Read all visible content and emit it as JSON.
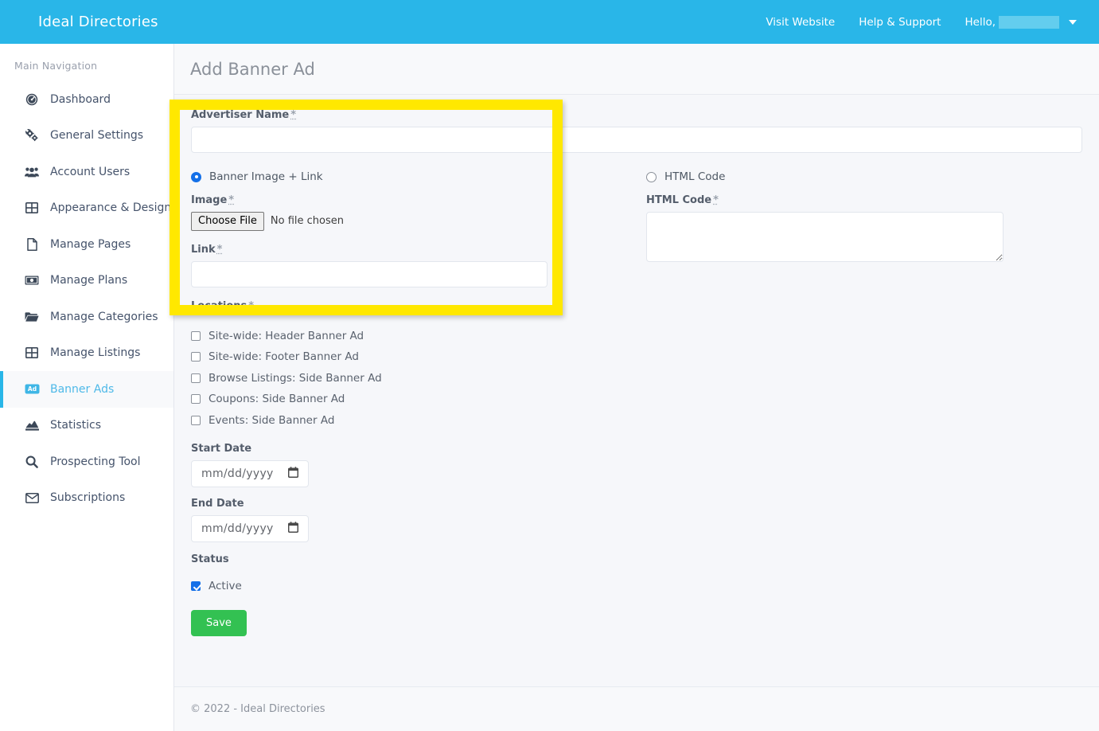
{
  "header": {
    "brand": "Ideal Directories",
    "links": [
      {
        "label": "Visit Website",
        "name": "visit-website"
      },
      {
        "label": "Help & Support",
        "name": "help-support"
      }
    ],
    "hello_label": "Hello,",
    "hello_user": "",
    "brand_color": "#29b6e8"
  },
  "sidebar": {
    "title": "Main Navigation",
    "items": [
      {
        "label": "Dashboard",
        "icon": "dashboard-icon"
      },
      {
        "label": "General Settings",
        "icon": "gears-icon"
      },
      {
        "label": "Account Users",
        "icon": "users-icon"
      },
      {
        "label": "Appearance & Design",
        "icon": "grid-icon"
      },
      {
        "label": "Manage Pages",
        "icon": "page-icon"
      },
      {
        "label": "Manage Plans",
        "icon": "money-icon"
      },
      {
        "label": "Manage Categories",
        "icon": "folder-icon"
      },
      {
        "label": "Manage Listings",
        "icon": "grid-icon"
      },
      {
        "label": "Banner Ads",
        "icon": "ad-icon",
        "active": true
      },
      {
        "label": "Statistics",
        "icon": "chart-icon"
      },
      {
        "label": "Prospecting Tool",
        "icon": "search-icon"
      },
      {
        "label": "Subscriptions",
        "icon": "envelope-icon"
      }
    ],
    "active_color": "#4eb9e8"
  },
  "page": {
    "title": "Add Banner Ad"
  },
  "form": {
    "advertiser": {
      "label": "Advertiser Name",
      "required_mark": "*",
      "value": "",
      "placeholder": ""
    },
    "banner_option": {
      "label": "Banner Image + Link",
      "selected": true
    },
    "image": {
      "label": "Image",
      "required_mark": "*",
      "button_label": "Choose File",
      "file_status": "No file chosen"
    },
    "link": {
      "label": "Link",
      "required_mark": "*",
      "value": "",
      "placeholder": ""
    },
    "html_option": {
      "label": "HTML Code",
      "selected": false
    },
    "html_code": {
      "label": "HTML Code",
      "required_mark": "*",
      "value": "",
      "placeholder": ""
    },
    "locations": {
      "label": "Locations",
      "required_mark": "*",
      "options": [
        {
          "label": "Site-wide: Header Banner Ad",
          "checked": false
        },
        {
          "label": "Site-wide: Footer Banner Ad",
          "checked": false
        },
        {
          "label": "Browse Listings: Side Banner Ad",
          "checked": false
        },
        {
          "label": "Coupons: Side Banner Ad",
          "checked": false
        },
        {
          "label": "Events: Side Banner Ad",
          "checked": false
        }
      ]
    },
    "start_date": {
      "label": "Start Date",
      "placeholder": "mm/dd/yyyy",
      "value": ""
    },
    "end_date": {
      "label": "End Date",
      "placeholder": "mm/dd/yyyy",
      "value": ""
    },
    "status": {
      "label": "Status",
      "active_label": "Active",
      "active_checked": true
    },
    "save_label": "Save",
    "save_color": "#33c152"
  },
  "footer": {
    "copyright": "© 2022 - Ideal Directories"
  },
  "highlight": {
    "color": "#ffe800"
  }
}
